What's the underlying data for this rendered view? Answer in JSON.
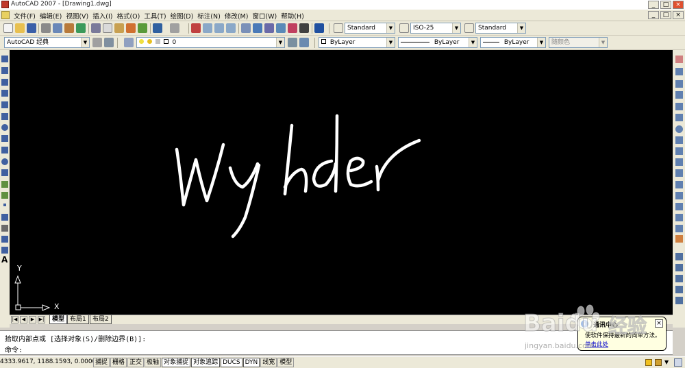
{
  "window": {
    "title": "AutoCAD 2007 - [Drawing1.dwg]",
    "buttons": [
      "_",
      "□",
      "×"
    ]
  },
  "menubar": {
    "items": [
      "文件(F)",
      "编辑(E)",
      "视图(V)",
      "插入(I)",
      "格式(O)",
      "工具(T)",
      "绘图(D)",
      "标注(N)",
      "修改(M)",
      "窗口(W)",
      "帮助(H)"
    ],
    "doc_buttons": [
      "_",
      "□",
      "×"
    ]
  },
  "toolbar1": {
    "text_style": "Standard",
    "dim_style": "ISO-25",
    "table_style": "Standard"
  },
  "toolbar2": {
    "workspace": "AutoCAD 经典",
    "layer": "0",
    "color": "ByLayer",
    "linetype": "ByLayer",
    "lineweight": "ByLayer",
    "plotstyle": "随颜色"
  },
  "canvas": {
    "background": "#000000",
    "handwriting": "Wyhder",
    "ucs_x_label": "X",
    "ucs_y_label": "Y"
  },
  "layout_tabs": {
    "nav": [
      "|◀",
      "◀",
      "▶",
      "▶|"
    ],
    "tabs": [
      "模型",
      "布局1",
      "布局2"
    ],
    "active": "模型"
  },
  "command": {
    "history": "拾取内部点或 [选择对象(S)/删除边界(B)]:",
    "prompt": "命令:"
  },
  "statusbar": {
    "coordinates": "4333.9617, 1188.1593, 0.0000",
    "toggles": [
      "捕捉",
      "栅格",
      "正交",
      "极轴",
      "对象捕捉",
      "对象追踪",
      "DUCS",
      "DYN",
      "线宽",
      "模型"
    ]
  },
  "notification": {
    "title": "通讯中心",
    "body": "使软件保持最新的简单方法。",
    "link": "单击此处"
  },
  "watermark": {
    "brand": "Baidu",
    "product": "经验",
    "url": "jingyan.baidu.com"
  },
  "colors": {
    "chrome": "#ece9d8",
    "canvas": "#000000",
    "ink": "#ffffff",
    "balloon": "#ffffe1"
  }
}
